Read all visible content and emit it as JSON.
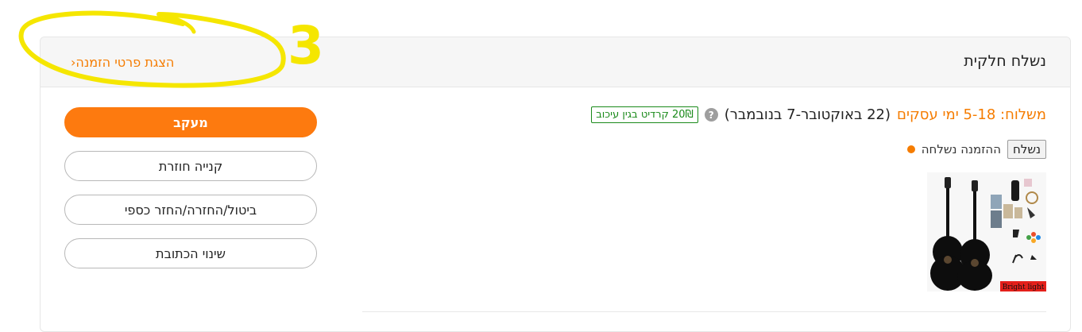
{
  "header": {
    "title": "נשלח חלקית",
    "details_link": "הצגת פרטי הזמנה"
  },
  "shipping": {
    "label": "משלוח: 5-18 ימי עסקים",
    "dates": "(22 באוקטובר-7 בנובמבר)",
    "help_icon": "?",
    "credit_amount": "20₪",
    "credit_text": "קרדיט בגין עיכוב"
  },
  "status": {
    "tag": "נשלח",
    "text": "ההזמנה נשלחה"
  },
  "product": {
    "image_caption": "Bright light"
  },
  "actions": {
    "track": "מעקב",
    "rebuy": "קנייה חוזרת",
    "cancel_return": "ביטול/החזרה/החזר כספי",
    "change_address": "שינוי הכתובת"
  },
  "annotation": {
    "number": "3",
    "color": "#f5e600"
  },
  "colors": {
    "accent": "#fd7a0f",
    "credit_green": "#1a8a1a"
  }
}
